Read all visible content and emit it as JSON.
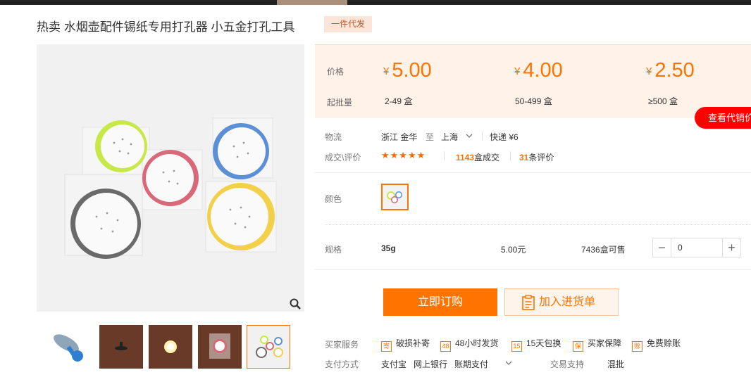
{
  "product": {
    "title": "热卖 水烟壶配件锡纸专用打孔器 小五金打孔工具",
    "tag": "一件代发"
  },
  "price_panel": {
    "price_label": "价格",
    "moq_label": "起批量",
    "currency": "¥",
    "tiers": [
      {
        "price": "5.00",
        "range": "2-49 盒"
      },
      {
        "price": "4.00",
        "range": "50-499 盒"
      },
      {
        "price": "2.50",
        "range": "≥500 盒"
      }
    ]
  },
  "dealer_button": "查看代销价",
  "logistics": {
    "label": "物流",
    "origin": "浙江 金华",
    "to": "至",
    "destination": "上海",
    "express": "快递 ¥6"
  },
  "reviews": {
    "label": "成交\\评价",
    "stars": "★★★★★",
    "deals_count": "1143",
    "deals_suffix": "盒成交",
    "review_count": "31",
    "review_suffix": "条评价"
  },
  "color": {
    "label": "颜色"
  },
  "spec": {
    "label": "规格",
    "name": "35g",
    "price": "5.00元",
    "stock": "7436盒可售",
    "quantity": "0",
    "minus": "−",
    "plus": "+"
  },
  "actions": {
    "buy_now": "立即订购",
    "add_to_list": "加入进货单"
  },
  "services": {
    "label": "买家服务",
    "items": [
      {
        "icon": "寄",
        "label": "破损补寄"
      },
      {
        "icon": "48",
        "label": "48小时发货"
      },
      {
        "icon": "15",
        "label": "15天包换"
      },
      {
        "icon": "保",
        "label": "买家保障"
      },
      {
        "icon": "赊",
        "label": "免费赊账"
      }
    ]
  },
  "payment": {
    "label": "支付方式",
    "methods": [
      "支付宝",
      "网上银行",
      "账期支付"
    ],
    "trade_support_label": "交易支持",
    "trade_support_value": "混批"
  },
  "colors": {
    "accent": "#ff7300",
    "price_bg": "#fff2e8",
    "dealer_red": "#ff0000"
  }
}
